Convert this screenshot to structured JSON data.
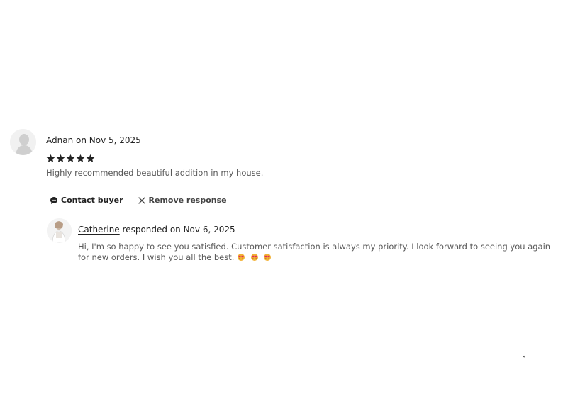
{
  "review": {
    "reviewer_name": "Adnan",
    "date_text": "on Nov 5, 2025",
    "rating": 5,
    "max_rating": 5,
    "text": "Highly recommended beautiful addition in my house."
  },
  "actions": {
    "contact_label": "Contact buyer",
    "remove_label": "Remove response"
  },
  "response": {
    "seller_name": "Catherine",
    "date_text": "responded on Nov 6, 2025",
    "text": "Hi, I'm so happy to see you satisfied. Customer satisfaction is always my priority. I look forward to seeing you again for new orders. I wish you all the best.",
    "emojis": [
      "heart-eyes-emoji",
      "heart-eyes-emoji",
      "heart-eyes-emoji"
    ]
  },
  "footer": {
    "mark": "»"
  },
  "colors": {
    "text_primary": "#222222",
    "text_secondary": "#595959",
    "star": "#222222"
  }
}
